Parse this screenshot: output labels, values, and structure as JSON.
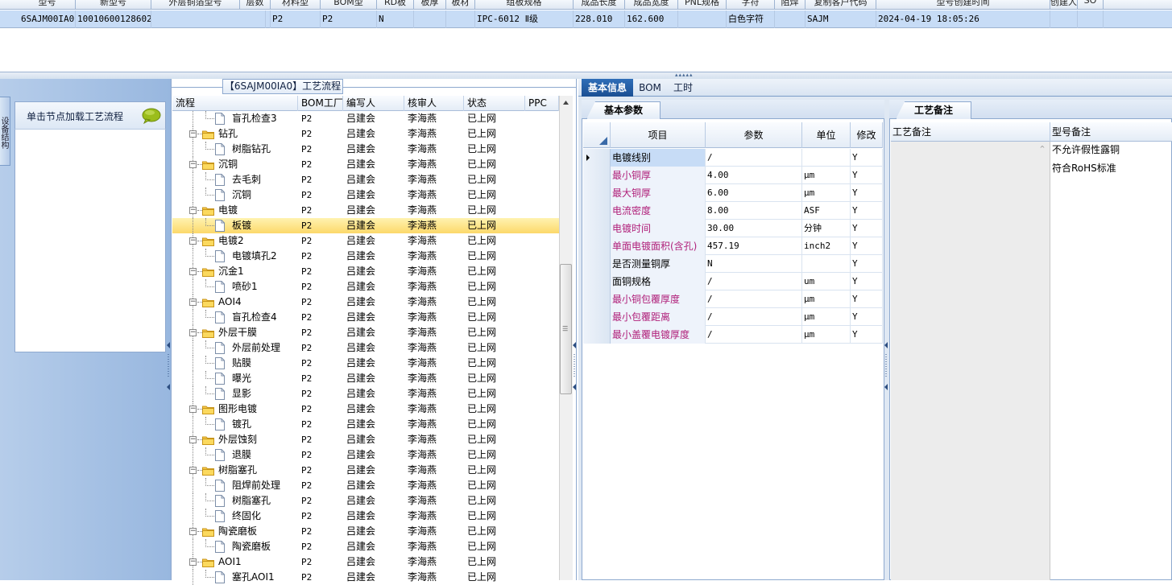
{
  "top_grid": {
    "header_partial": [
      "型号",
      "新型号",
      "外层铜箔型号",
      "层数",
      "材料型",
      "BOM型",
      "RD板",
      "板厚",
      "板材",
      "组板规格",
      "成品长度",
      "成品宽度",
      "PNL规格",
      "字符",
      "阻焊",
      "复制客户代码",
      "型号创建时间",
      "创建人",
      "SO"
    ],
    "row": {
      "code": "6SAJM00IA0",
      "number": "10010600128602",
      "col3": "",
      "col4": "",
      "p1": "P2",
      "p2": "P2",
      "flag": "N",
      "col8": "",
      "col9": "",
      "spec": "IPC-6012 Ⅱ级",
      "length": "228.010",
      "width": "162.600",
      "col13": "",
      "char": "白色字符",
      "col15": "",
      "customer": "SAJM",
      "created": "2024-04-19 18:05:26"
    }
  },
  "left_panel": {
    "side_tab": "设备结构",
    "node_prompt": "单击节点加载工艺流程"
  },
  "tree": {
    "title": "【6SAJM00IA0】工艺流程",
    "headers": [
      "流程",
      "BOM工厂",
      "编写人",
      "核审人",
      "状态",
      "PPC"
    ],
    "rows": [
      {
        "label": "盲孔检查3",
        "level": 1,
        "bom": "P2",
        "writer": "吕建会",
        "reviewer": "李海燕",
        "status": "已上网"
      },
      {
        "label": "钻孔",
        "level": 0,
        "bom": "P2",
        "writer": "吕建会",
        "reviewer": "李海燕",
        "status": "已上网"
      },
      {
        "label": "树脂钻孔",
        "level": 1,
        "bom": "P2",
        "writer": "吕建会",
        "reviewer": "李海燕",
        "status": "已上网"
      },
      {
        "label": "沉铜",
        "level": 0,
        "bom": "P2",
        "writer": "吕建会",
        "reviewer": "李海燕",
        "status": "已上网"
      },
      {
        "label": "去毛刺",
        "level": 1,
        "bom": "P2",
        "writer": "吕建会",
        "reviewer": "李海燕",
        "status": "已上网"
      },
      {
        "label": "沉铜",
        "level": 1,
        "bom": "P2",
        "writer": "吕建会",
        "reviewer": "李海燕",
        "status": "已上网"
      },
      {
        "label": "电镀",
        "level": 0,
        "bom": "P2",
        "writer": "吕建会",
        "reviewer": "李海燕",
        "status": "已上网"
      },
      {
        "label": "板镀",
        "level": 1,
        "bom": "P2",
        "writer": "吕建会",
        "reviewer": "李海燕",
        "status": "已上网",
        "selected": true
      },
      {
        "label": "电镀2",
        "level": 0,
        "bom": "P2",
        "writer": "吕建会",
        "reviewer": "李海燕",
        "status": "已上网"
      },
      {
        "label": "电镀填孔2",
        "level": 1,
        "bom": "P2",
        "writer": "吕建会",
        "reviewer": "李海燕",
        "status": "已上网"
      },
      {
        "label": "沉金1",
        "level": 0,
        "bom": "P2",
        "writer": "吕建会",
        "reviewer": "李海燕",
        "status": "已上网"
      },
      {
        "label": "喷砂1",
        "level": 1,
        "bom": "P2",
        "writer": "吕建会",
        "reviewer": "李海燕",
        "status": "已上网"
      },
      {
        "label": "AOI4",
        "level": 0,
        "bom": "P2",
        "writer": "吕建会",
        "reviewer": "李海燕",
        "status": "已上网"
      },
      {
        "label": "盲孔检查4",
        "level": 1,
        "bom": "P2",
        "writer": "吕建会",
        "reviewer": "李海燕",
        "status": "已上网"
      },
      {
        "label": "外层干膜",
        "level": 0,
        "bom": "P2",
        "writer": "吕建会",
        "reviewer": "李海燕",
        "status": "已上网"
      },
      {
        "label": "外层前处理",
        "level": 1,
        "bom": "P2",
        "writer": "吕建会",
        "reviewer": "李海燕",
        "status": "已上网"
      },
      {
        "label": "贴膜",
        "level": 1,
        "bom": "P2",
        "writer": "吕建会",
        "reviewer": "李海燕",
        "status": "已上网"
      },
      {
        "label": "曝光",
        "level": 1,
        "bom": "P2",
        "writer": "吕建会",
        "reviewer": "李海燕",
        "status": "已上网"
      },
      {
        "label": "显影",
        "level": 1,
        "bom": "P2",
        "writer": "吕建会",
        "reviewer": "李海燕",
        "status": "已上网"
      },
      {
        "label": "图形电镀",
        "level": 0,
        "bom": "P2",
        "writer": "吕建会",
        "reviewer": "李海燕",
        "status": "已上网"
      },
      {
        "label": "镀孔",
        "level": 1,
        "bom": "P2",
        "writer": "吕建会",
        "reviewer": "李海燕",
        "status": "已上网"
      },
      {
        "label": "外层蚀刻",
        "level": 0,
        "bom": "P2",
        "writer": "吕建会",
        "reviewer": "李海燕",
        "status": "已上网"
      },
      {
        "label": "退膜",
        "level": 1,
        "bom": "P2",
        "writer": "吕建会",
        "reviewer": "李海燕",
        "status": "已上网"
      },
      {
        "label": "树脂塞孔",
        "level": 0,
        "bom": "P2",
        "writer": "吕建会",
        "reviewer": "李海燕",
        "status": "已上网"
      },
      {
        "label": "阻焊前处理",
        "level": 1,
        "bom": "P2",
        "writer": "吕建会",
        "reviewer": "李海燕",
        "status": "已上网"
      },
      {
        "label": "树脂塞孔",
        "level": 1,
        "bom": "P2",
        "writer": "吕建会",
        "reviewer": "李海燕",
        "status": "已上网"
      },
      {
        "label": "终固化",
        "level": 1,
        "bom": "P2",
        "writer": "吕建会",
        "reviewer": "李海燕",
        "status": "已上网"
      },
      {
        "label": "陶瓷磨板",
        "level": 0,
        "bom": "P2",
        "writer": "吕建会",
        "reviewer": "李海燕",
        "status": "已上网"
      },
      {
        "label": "陶瓷磨板",
        "level": 1,
        "bom": "P2",
        "writer": "吕建会",
        "reviewer": "李海燕",
        "status": "已上网"
      },
      {
        "label": "AOI1",
        "level": 0,
        "bom": "P2",
        "writer": "吕建会",
        "reviewer": "李海燕",
        "status": "已上网"
      },
      {
        "label": "塞孔AOI1",
        "level": 1,
        "bom": "P2",
        "writer": "吕建会",
        "reviewer": "李海燕",
        "status": "已上网"
      }
    ]
  },
  "tabs": [
    {
      "label": "基本信息",
      "active": true
    },
    {
      "label": "BOM",
      "active": false
    },
    {
      "label": "工时",
      "active": false
    }
  ],
  "params": {
    "tab_label": "基本参数",
    "headers": [
      "项目",
      "参数",
      "单位",
      "修改"
    ],
    "rows": [
      {
        "item": "电镀线别",
        "value": "/",
        "unit": "",
        "modify": "Y",
        "pink": false,
        "current": true
      },
      {
        "item": "最小铜厚",
        "value": "4.00",
        "unit": "μm",
        "modify": "Y",
        "pink": true
      },
      {
        "item": "最大铜厚",
        "value": "6.00",
        "unit": "μm",
        "modify": "Y",
        "pink": true
      },
      {
        "item": "电流密度",
        "value": "8.00",
        "unit": "ASF",
        "modify": "Y",
        "pink": true
      },
      {
        "item": "电镀时间",
        "value": "30.00",
        "unit": "分钟",
        "modify": "Y",
        "pink": true
      },
      {
        "item": "单面电镀面积(含孔)",
        "value": "457.19",
        "unit": "inch2",
        "modify": "Y",
        "pink": true
      },
      {
        "item": "是否测量铜厚",
        "value": "N",
        "unit": "",
        "modify": "Y",
        "pink": false
      },
      {
        "item": "面铜规格",
        "value": "/",
        "unit": "um",
        "modify": "Y",
        "pink": false
      },
      {
        "item": "最小铜包覆厚度",
        "value": "/",
        "unit": "μm",
        "modify": "Y",
        "pink": true
      },
      {
        "item": "最小包覆距离",
        "value": "/",
        "unit": "μm",
        "modify": "Y",
        "pink": true
      },
      {
        "item": "最小盖覆电镀厚度",
        "value": "/",
        "unit": "μm",
        "modify": "Y",
        "pink": true
      }
    ]
  },
  "notes": {
    "tab_label": "工艺备注",
    "col1": "工艺备注",
    "col2": "型号备注",
    "lines": [
      "不允许假性露铜",
      "符合RoHS标准"
    ]
  },
  "colors": {
    "selection_yellow": "#fcd86a",
    "header_blue": "#1b4f93",
    "pink_text": "#b0207a",
    "sidebar_blue": "#98b7df"
  }
}
